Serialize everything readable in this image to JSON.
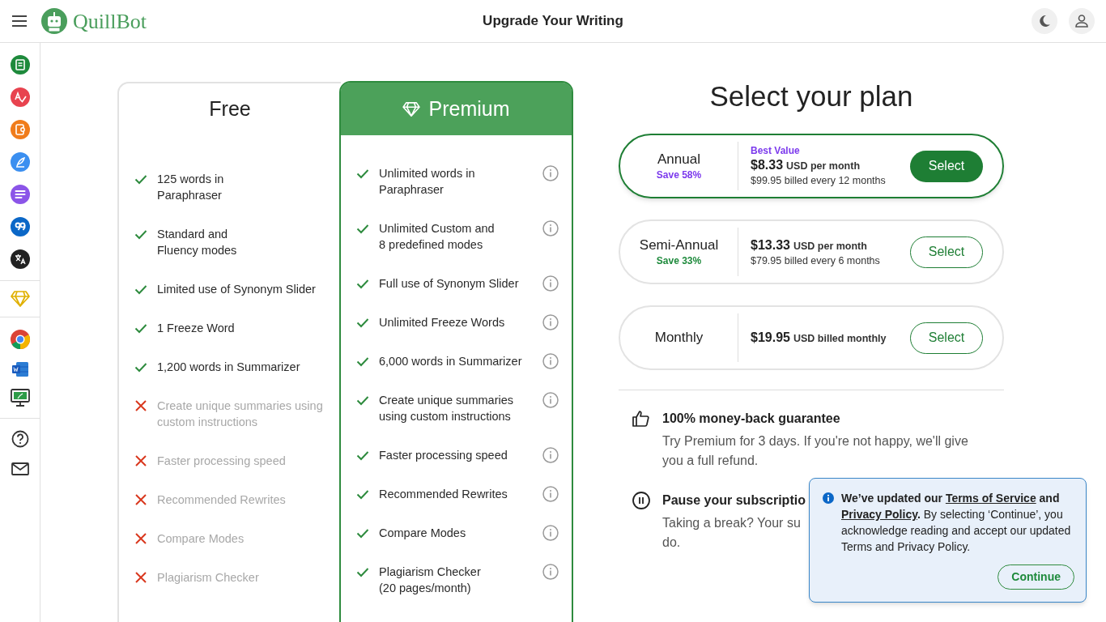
{
  "header": {
    "brand": "QuillBot",
    "title": "Upgrade Your Writing"
  },
  "free_card": {
    "title": "Free",
    "features": [
      {
        "text": "125 words in\nParaphraser",
        "included": true
      },
      {
        "text": "Standard and\nFluency modes",
        "included": true
      },
      {
        "text": "Limited use of Synonym Slider",
        "included": true
      },
      {
        "text": "1 Freeze Word",
        "included": true
      },
      {
        "text": "1,200 words in Summarizer",
        "included": true
      },
      {
        "text": "Create unique summaries using\ncustom instructions",
        "included": false
      },
      {
        "text": "Faster processing speed",
        "included": false
      },
      {
        "text": "Recommended Rewrites",
        "included": false
      },
      {
        "text": "Compare Modes",
        "included": false
      },
      {
        "text": "Plagiarism Checker",
        "included": false
      }
    ]
  },
  "premium_card": {
    "title": "Premium",
    "features": [
      {
        "text": "Unlimited words in\nParaphraser",
        "included": true
      },
      {
        "text": "Unlimited Custom and\n8 predefined modes",
        "included": true
      },
      {
        "text": "Full use of Synonym Slider",
        "included": true
      },
      {
        "text": "Unlimited Freeze Words",
        "included": true
      },
      {
        "text": "6,000 words in Summarizer",
        "included": true
      },
      {
        "text": "Create unique summaries\nusing custom instructions",
        "included": true
      },
      {
        "text": "Faster processing speed",
        "included": true
      },
      {
        "text": "Recommended Rewrites",
        "included": true
      },
      {
        "text": "Compare Modes",
        "included": true
      },
      {
        "text": "Plagiarism Checker\n(20 pages/month)",
        "included": true
      }
    ]
  },
  "plans_heading": "Select your plan",
  "plans": [
    {
      "name": "Annual",
      "save": "Save 58%",
      "color": "#7c3aed",
      "badge": "Best Value",
      "price": "$8.33",
      "unit": "USD per month",
      "billed": "$99.95 billed every 12 months",
      "button": "Select",
      "selected": true
    },
    {
      "name": "Semi-Annual",
      "save": "Save 33%",
      "color": "#1e8a3c",
      "price": "$13.33",
      "unit": "USD per month",
      "billed": "$79.95 billed every 6 months",
      "button": "Select",
      "selected": false
    },
    {
      "name": "Monthly",
      "price": "$19.95",
      "unit": "USD billed monthly",
      "button": "Select",
      "selected": false
    }
  ],
  "benefits": [
    {
      "kind": "thumbs",
      "title": "100% money-back guarantee",
      "body": "Try Premium for 3 days. If you're not happy, we'll give you a full refund."
    },
    {
      "kind": "pause",
      "title": "Pause your subscriptio",
      "body": "Taking a break? Your su",
      "body_tail": "do."
    }
  ],
  "toast": {
    "message": [
      {
        "kind": "bold",
        "text": "We’ve updated our "
      },
      {
        "kind": "link",
        "text": "Terms of Service"
      },
      {
        "kind": "bold",
        "text": " and "
      },
      {
        "kind": "link",
        "text": "Privacy Policy"
      },
      {
        "kind": "bold",
        "text": "."
      },
      {
        "kind": "plain",
        "text": " By selecting ‘Continue’, you acknowledge reading and accept our updated Terms and Privacy Policy."
      }
    ],
    "button": "Continue"
  }
}
